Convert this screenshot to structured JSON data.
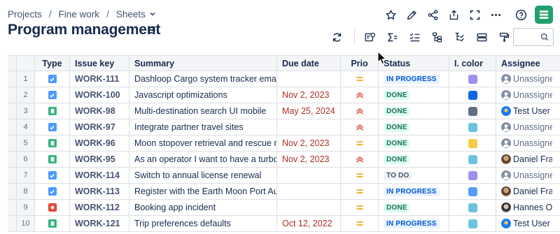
{
  "breadcrumb": {
    "items": [
      "Projects",
      "Fine work",
      "Sheets"
    ]
  },
  "title": "Program management",
  "columns": [
    "Type",
    "Issue key",
    "Summary",
    "Due date",
    "Prio",
    "Status",
    "I. color",
    "Assignee"
  ],
  "rows": [
    {
      "num": "1",
      "type": "task",
      "key": "WORK-111",
      "summary": "Dashloop Cargo system tracker email...",
      "due": "",
      "prio": "medium",
      "status": "IN PROGRESS",
      "color": "#9f8fef",
      "assignee": "Unassigned",
      "avatar": "unassigned"
    },
    {
      "num": "2",
      "type": "task",
      "key": "WORK-100",
      "summary": "Javascript optimizations",
      "due": "Nov 2, 2023",
      "prio": "high",
      "status": "DONE",
      "color": "#0c66e4",
      "assignee": "Unassigned",
      "avatar": "unassigned"
    },
    {
      "num": "3",
      "type": "story",
      "key": "WORK-98",
      "summary": "Multi-destination search UI mobile",
      "due": "May 25, 2024",
      "prio": "high",
      "status": "DONE",
      "color": "#626f86",
      "assignee": "Test User",
      "avatar": "test"
    },
    {
      "num": "4",
      "type": "task",
      "key": "WORK-97",
      "summary": "Integrate partner travel sites",
      "due": "",
      "prio": "high",
      "status": "DONE",
      "color": "#6cc3e0",
      "assignee": "Unassigned",
      "avatar": "unassigned"
    },
    {
      "num": "5",
      "type": "story",
      "key": "WORK-96",
      "summary": "Moon stopover retrieval and rescue m...",
      "due": "Nov 2, 2023",
      "prio": "medium",
      "status": "DONE",
      "color": "#f5cd47",
      "assignee": "Unassigned",
      "avatar": "unassigned"
    },
    {
      "num": "6",
      "type": "story",
      "key": "WORK-95",
      "summary": "As an operator I want to have a turbo ...",
      "due": "Nov 2, 2023",
      "prio": "high",
      "status": "DONE",
      "color": "#6cc3e0",
      "assignee": "Daniel Fran",
      "avatar": "photo1"
    },
    {
      "num": "7",
      "type": "task",
      "key": "WORK-114",
      "summary": "Switch to annual license renewal",
      "due": "",
      "prio": "medium",
      "status": "TO DO",
      "color": "#9f8fef",
      "assignee": "Unassigned",
      "avatar": "unassigned"
    },
    {
      "num": "8",
      "type": "task",
      "key": "WORK-113",
      "summary": "Register with the Earth Moon Port Aut...",
      "due": "",
      "prio": "medium",
      "status": "IN PROGRESS",
      "color": "#579dff",
      "assignee": "Daniel Fran",
      "avatar": "photo1"
    },
    {
      "num": "9",
      "type": "bug",
      "key": "WORK-112",
      "summary": "Booking app incident",
      "due": "",
      "prio": "medium",
      "status": "DONE",
      "color": "#6cc3e0",
      "assignee": "Hannes Obt",
      "avatar": "photo2"
    },
    {
      "num": "10",
      "type": "story",
      "key": "WORK-121",
      "summary": "Trip preferences defaults",
      "due": "Oct 12, 2022",
      "prio": "medium",
      "status": "IN PROGRESS",
      "color": "#6cc3e0",
      "assignee": "Test User",
      "avatar": "test"
    }
  ],
  "colors": {
    "task": "#4c9aff",
    "story": "#36b37e",
    "bug": "#e34935",
    "prio_medium": "#f5a623",
    "prio_high": "#e2483d",
    "brand": "#22a06b"
  },
  "icons": {
    "top": [
      "star-icon",
      "edit-icon",
      "share-icon",
      "export-icon",
      "fullscreen-icon",
      "more-icon",
      "help-icon",
      "app-logo"
    ],
    "toolbar": [
      "refresh-icon",
      "card-view-icon",
      "sum-icon",
      "checklist-icon",
      "hierarchy-icon",
      "hierarchy-check-icon",
      "rows-icon",
      "format-painter-icon",
      "search-icon"
    ]
  }
}
